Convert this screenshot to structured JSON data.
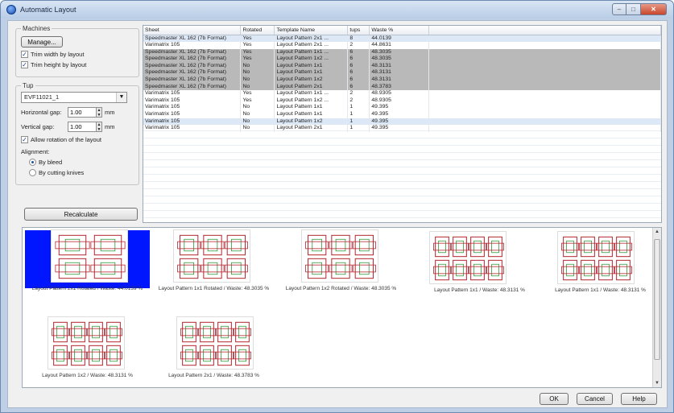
{
  "window": {
    "title": "Automatic Layout",
    "controls": [
      "–",
      "□",
      "✕"
    ]
  },
  "machines": {
    "legend": "Machines",
    "manage_label": "Manage...",
    "trim_width_label": "Trim width by layout",
    "trim_width_checked": true,
    "trim_height_label": "Trim height by layout",
    "trim_height_checked": true
  },
  "tup": {
    "legend": "Tup",
    "selected": "EVF11021_1",
    "horizontal_gap_label": "Horizontal gap:",
    "horizontal_gap_value": "1.00",
    "vertical_gap_label": "Vertical gap:",
    "vertical_gap_value": "1.00",
    "unit": "mm",
    "allow_rotation_label": "Allow rotation of the layout",
    "allow_rotation_checked": true,
    "alignment_label": "Alignment:",
    "by_bleed_label": "By bleed",
    "by_cutting_knives_label": "By cutting knives",
    "alignment_selected": "by_bleed"
  },
  "recalculate_label": "Recalculate",
  "table": {
    "columns": [
      "Sheet",
      "Rotated",
      "Template Name",
      "tups",
      "Waste %"
    ],
    "rows": [
      [
        "Speedmaster XL 162 (7b Format)",
        "Yes",
        "Layout Pattern 2x1 ...",
        "8",
        "44.0139"
      ],
      [
        "Varimatrix 105",
        "Yes",
        "Layout Pattern 2x1 ...",
        "2",
        "44.8631"
      ],
      [
        "Speedmaster XL 162 (7b Format)",
        "Yes",
        "Layout Pattern 1x1 ...",
        "6",
        "48.3035"
      ],
      [
        "Speedmaster XL 162 (7b Format)",
        "Yes",
        "Layout Pattern 1x2 ...",
        "6",
        "48.3035"
      ],
      [
        "Speedmaster XL 162 (7b Format)",
        "No",
        "Layout Pattern 1x1",
        "6",
        "48.3131"
      ],
      [
        "Speedmaster XL 162 (7b Format)",
        "No",
        "Layout Pattern 1x1",
        "6",
        "48.3131"
      ],
      [
        "Speedmaster XL 162 (7b Format)",
        "No",
        "Layout Pattern 1x2",
        "6",
        "48.3131"
      ],
      [
        "Speedmaster XL 162 (7b Format)",
        "No",
        "Layout Pattern 2x1",
        "6",
        "48.3783"
      ],
      [
        "Varimatrix 105",
        "Yes",
        "Layout Pattern 1x1 ...",
        "2",
        "48.9305"
      ],
      [
        "Varimatrix 105",
        "Yes",
        "Layout Pattern 1x2 ...",
        "2",
        "48.9305"
      ],
      [
        "Varimatrix 105",
        "No",
        "Layout Pattern 1x1",
        "1",
        "49.395"
      ],
      [
        "Varimatrix 105",
        "No",
        "Layout Pattern 1x1",
        "1",
        "49.395"
      ],
      [
        "Varimatrix 105",
        "No",
        "Layout Pattern 1x2",
        "1",
        "49.395"
      ],
      [
        "Varimatrix 105",
        "No",
        "Layout Pattern 2x1",
        "1",
        "49.395"
      ]
    ],
    "row_states": [
      "sel",
      "",
      "hl",
      "hl",
      "hl",
      "hl",
      "hl",
      "hl",
      "",
      "",
      "",
      "",
      "sel",
      ""
    ]
  },
  "previews": [
    {
      "caption": "Layout Pattern 2x1 Rotated / Waste: 44.0139 %",
      "selected": true
    },
    {
      "caption": "Layout Pattern 1x1 Rotated / Waste: 48.3035 %",
      "selected": false
    },
    {
      "caption": "Layout Pattern 1x2 Rotated / Waste: 48.3035 %",
      "selected": false
    },
    {
      "caption": "Layout Pattern 1x1 / Waste: 48.3131 %",
      "selected": false
    },
    {
      "caption": "Layout Pattern 1x1 / Waste: 48.3131 %",
      "selected": false
    },
    {
      "caption": "Layout Pattern 1x2 / Waste: 48.3131 %",
      "selected": false
    },
    {
      "caption": "Layout Pattern 2x1 / Waste: 48.3783 %",
      "selected": false
    }
  ],
  "buttons": {
    "ok": "OK",
    "cancel": "Cancel",
    "help": "Help"
  },
  "colors": {
    "selection_blue": "#0016ff",
    "row_highlight": "#b9b9b9",
    "row_selected": "#dde8f6"
  }
}
